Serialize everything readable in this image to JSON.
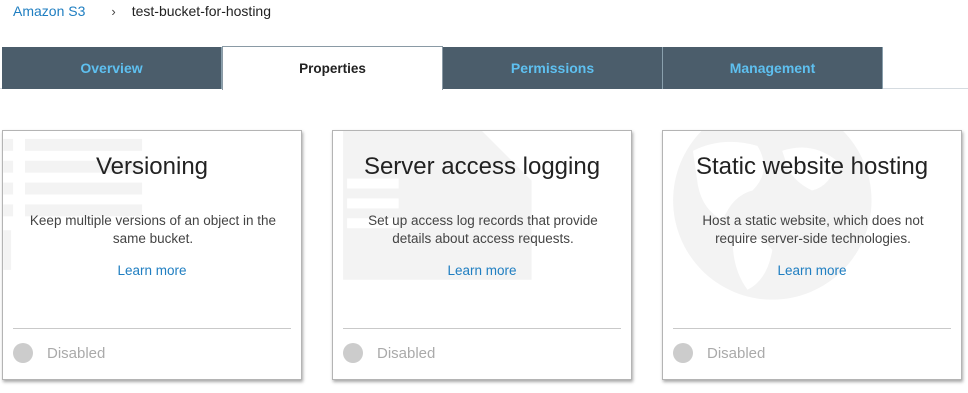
{
  "breadcrumb": {
    "root": "Amazon S3",
    "separator": "›",
    "current": "test-bucket-for-hosting"
  },
  "tabs": [
    {
      "label": "Overview",
      "active": false
    },
    {
      "label": "Properties",
      "active": true
    },
    {
      "label": "Permissions",
      "active": false
    },
    {
      "label": "Management",
      "active": false
    }
  ],
  "cards": [
    {
      "title": "Versioning",
      "description": "Keep multiple versions of an object in the same bucket.",
      "learn_more": "Learn more",
      "status": "Disabled",
      "icon": "versioning-icon"
    },
    {
      "title": "Server access logging",
      "description": "Set up access log records that provide details about access requests.",
      "learn_more": "Learn more",
      "status": "Disabled",
      "icon": "logging-icon"
    },
    {
      "title": "Static website hosting",
      "description": "Host a static website, which does not require server-side technologies.",
      "learn_more": "Learn more",
      "status": "Disabled",
      "icon": "globe-icon"
    }
  ],
  "colors": {
    "link": "#1f7ec1",
    "tab_inactive_bg": "#4b5d6b",
    "tab_inactive_text": "#5ec0f0",
    "status_disabled": "#cccccc"
  }
}
